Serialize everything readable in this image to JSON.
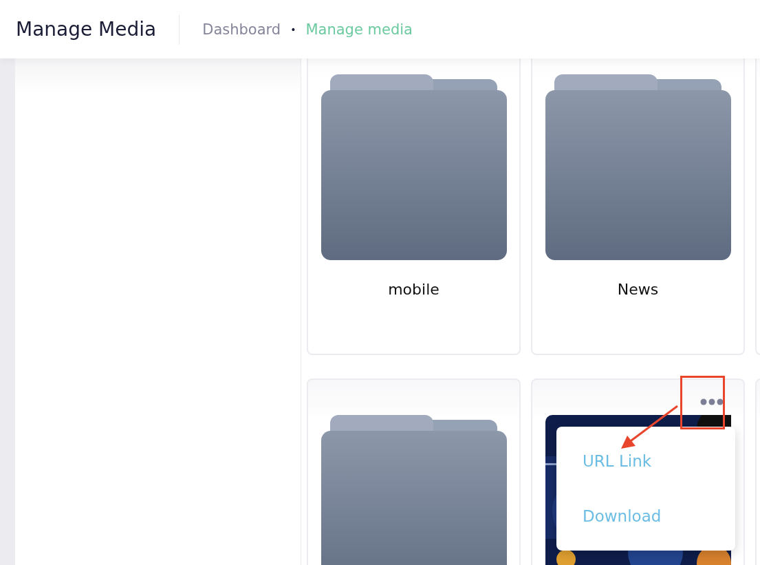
{
  "header": {
    "title": "Manage Media",
    "separator": "•",
    "breadcrumb": [
      {
        "label": "Dashboard",
        "current": false
      },
      {
        "label": "Manage media",
        "current": true
      }
    ]
  },
  "items": [
    {
      "kind": "folder",
      "name": "mobile"
    },
    {
      "kind": "folder",
      "name": "News"
    },
    {
      "kind": "blank"
    },
    {
      "kind": "folder"
    },
    {
      "menu_open": true,
      "menu": [
        "URL Link",
        "Download"
      ]
    },
    {
      "kind": "blank"
    }
  ]
}
